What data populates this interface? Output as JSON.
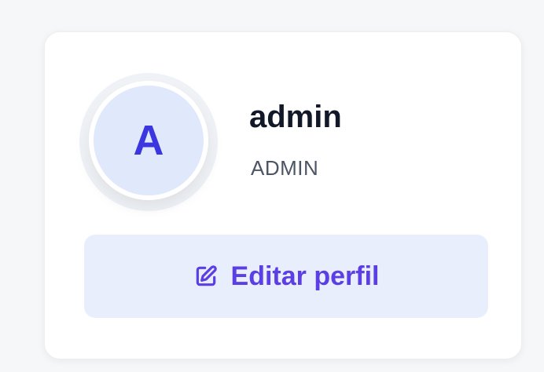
{
  "profile": {
    "avatar_initial": "A",
    "name": "admin",
    "role": "ADMIN",
    "edit_label": "Editar perfil",
    "edit_icon": "edit-square-pen-icon"
  },
  "colors": {
    "accent": "#5b3fe4",
    "avatar_bg": "#dfe9fb",
    "avatar_letter": "#3b36e0",
    "button_bg": "#e8eefc"
  }
}
